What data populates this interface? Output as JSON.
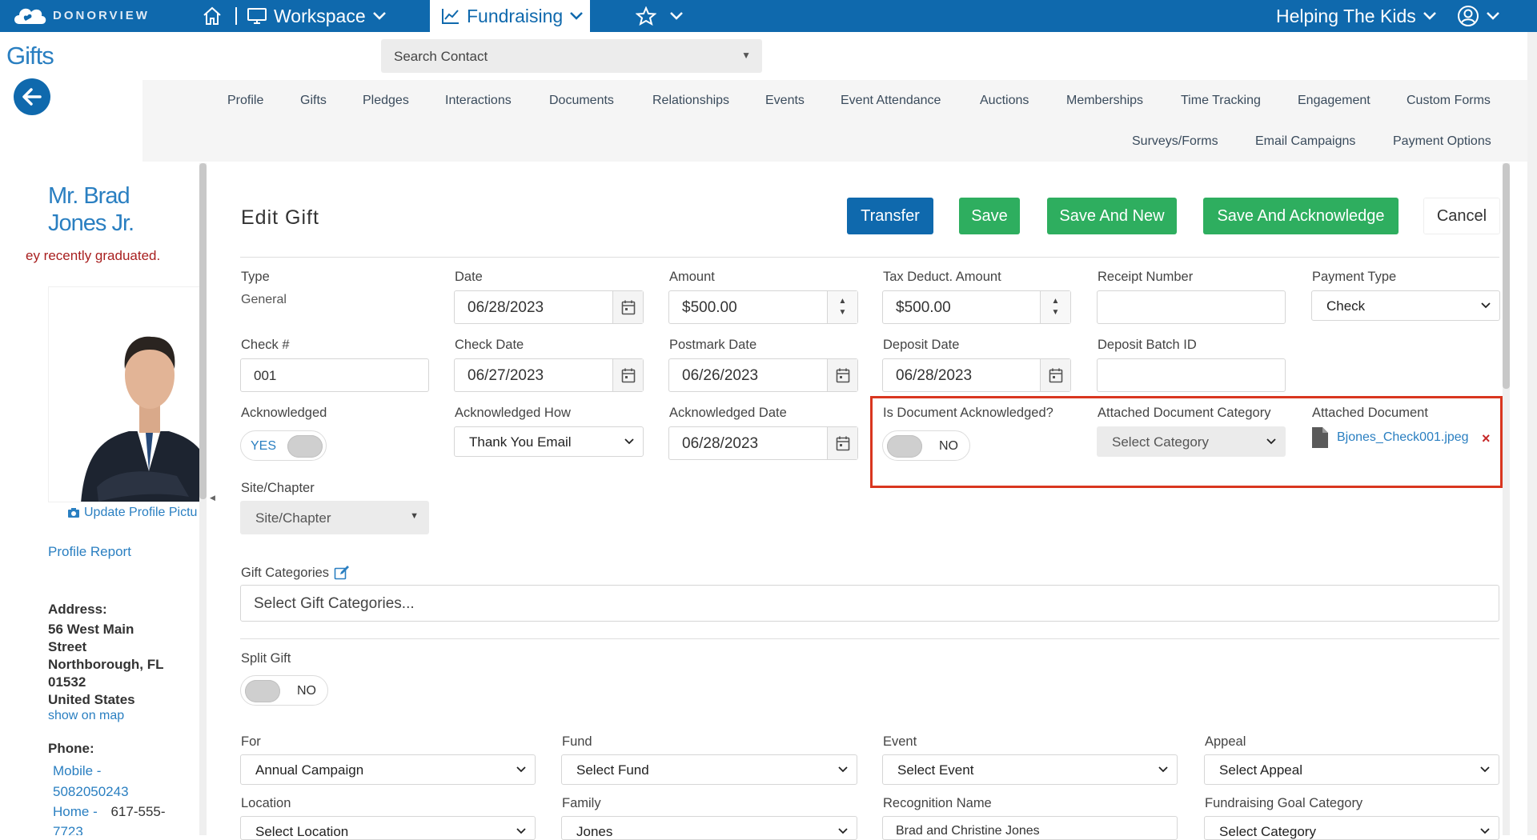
{
  "topbar": {
    "brand": "DONORVIEW",
    "workspace": "Workspace",
    "fundraising": "Fundraising",
    "org": "Helping The Kids"
  },
  "page_title": "Gifts",
  "search_contact": {
    "placeholder": "Search Contact"
  },
  "subnav": {
    "row1": [
      "Profile",
      "Gifts",
      "Pledges",
      "Interactions",
      "Documents",
      "Relationships",
      "Events",
      "Event Attendance",
      "Auctions",
      "Memberships",
      "Time Tracking",
      "Engagement",
      "Custom Forms"
    ],
    "row2": [
      "Surveys/Forms",
      "Email Campaigns",
      "Payment Options"
    ]
  },
  "profile": {
    "name_line1": "Mr. Brad",
    "name_line2": "Jones Jr.",
    "note": "ey recently graduated.",
    "update_picture": "Update Profile Pictu",
    "profile_report": "Profile Report",
    "address_label": "Address:",
    "address_lines": [
      "56 West Main",
      "Street",
      "Northborough, FL",
      "01532",
      "United States"
    ],
    "show_on_map": "show on map",
    "phone_label": "Phone:",
    "mobile_label": "Mobile -",
    "mobile_number": "5082050243",
    "home_label": "Home -",
    "home_number": "617-555-",
    "home_number_cont": "7723"
  },
  "form": {
    "title": "Edit Gift",
    "buttons": {
      "transfer": "Transfer",
      "save": "Save",
      "save_and_new": "Save And New",
      "save_and_acknowledge": "Save And Acknowledge",
      "cancel": "Cancel"
    },
    "type_label": "Type",
    "type_value": "General",
    "date_label": "Date",
    "date_value": "06/28/2023",
    "amount_label": "Amount",
    "amount_value": "$500.00",
    "tax_label": "Tax Deduct. Amount",
    "tax_value": "$500.00",
    "receipt_label": "Receipt Number",
    "receipt_value": "",
    "payment_type_label": "Payment Type",
    "payment_type_value": "Check",
    "check_num_label": "Check #",
    "check_num_value": "001",
    "check_date_label": "Check Date",
    "check_date_value": "06/27/2023",
    "postmark_label": "Postmark Date",
    "postmark_value": "06/26/2023",
    "deposit_label": "Deposit Date",
    "deposit_value": "06/28/2023",
    "batch_label": "Deposit Batch ID",
    "batch_value": "",
    "ack_label": "Acknowledged",
    "ack_toggle": "YES",
    "ack_how_label": "Acknowledged How",
    "ack_how_value": "Thank You Email",
    "ack_date_label": "Acknowledged Date",
    "ack_date_value": "06/28/2023",
    "doc_ack_label": "Is Document Acknowledged?",
    "doc_ack_toggle": "NO",
    "doc_cat_label": "Attached Document Category",
    "doc_cat_value": "Select Category",
    "doc_label": "Attached Document",
    "doc_file": "Bjones_Check001.jpeg",
    "doc_remove": "×",
    "site_label": "Site/Chapter",
    "site_value": "Site/Chapter",
    "gift_cat_label": "Gift Categories",
    "gift_cat_placeholder": "Select Gift Categories...",
    "split_label": "Split Gift",
    "split_toggle": "NO",
    "for_label": "For",
    "for_value": "Annual Campaign",
    "fund_label": "Fund",
    "fund_value": "Select Fund",
    "event_label": "Event",
    "event_value": "Select Event",
    "appeal_label": "Appeal",
    "appeal_value": "Select Appeal",
    "location_label": "Location",
    "location_value": "Select Location",
    "family_label": "Family",
    "family_value": "Jones",
    "recognition_label": "Recognition Name",
    "recognition_value": "Brad and Christine Jones",
    "goal_cat_label": "Fundraising Goal Category",
    "goal_cat_value": "Select Category"
  },
  "colors": {
    "primary": "#0f69ad",
    "success": "#2eae5f",
    "highlight": "#d9361f",
    "link": "#2a7fc1"
  }
}
